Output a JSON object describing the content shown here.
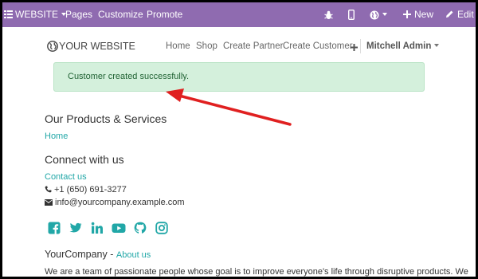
{
  "topbar": {
    "website_label": "WEBSITE",
    "pages_label": "Pages",
    "customize_label": "Customize",
    "promote_label": "Promote",
    "new_label": "New",
    "edit_label": "Edit",
    "bg_color": "#8f6bb0"
  },
  "nav": {
    "logo_text": "YOUR WEBSITE",
    "links": [
      "Home",
      "Shop",
      "Create Partner",
      "Create Customer"
    ],
    "user_name": "Mitchell Admin"
  },
  "alert": {
    "message": "Customer created successfully.",
    "bg_color": "#d4f0dc",
    "text_color": "#216334"
  },
  "products": {
    "heading": "Our Products & Services",
    "home_link": "Home"
  },
  "connect": {
    "heading": "Connect with us",
    "contact_link": "Contact us",
    "phone": "+1 (650) 691-3277",
    "email": "info@yourcompany.example.com"
  },
  "socials": [
    "facebook-icon",
    "twitter-icon",
    "linkedin-icon",
    "youtube-icon",
    "github-icon",
    "instagram-icon"
  ],
  "company": {
    "name": "YourCompany",
    "separator": " - ",
    "about_link": "About us",
    "description": "We are a team of passionate people whose goal is to improve everyone's life through disruptive products. We"
  },
  "annotation_arrow_color": "#e02020",
  "link_color": "#21a7a7"
}
